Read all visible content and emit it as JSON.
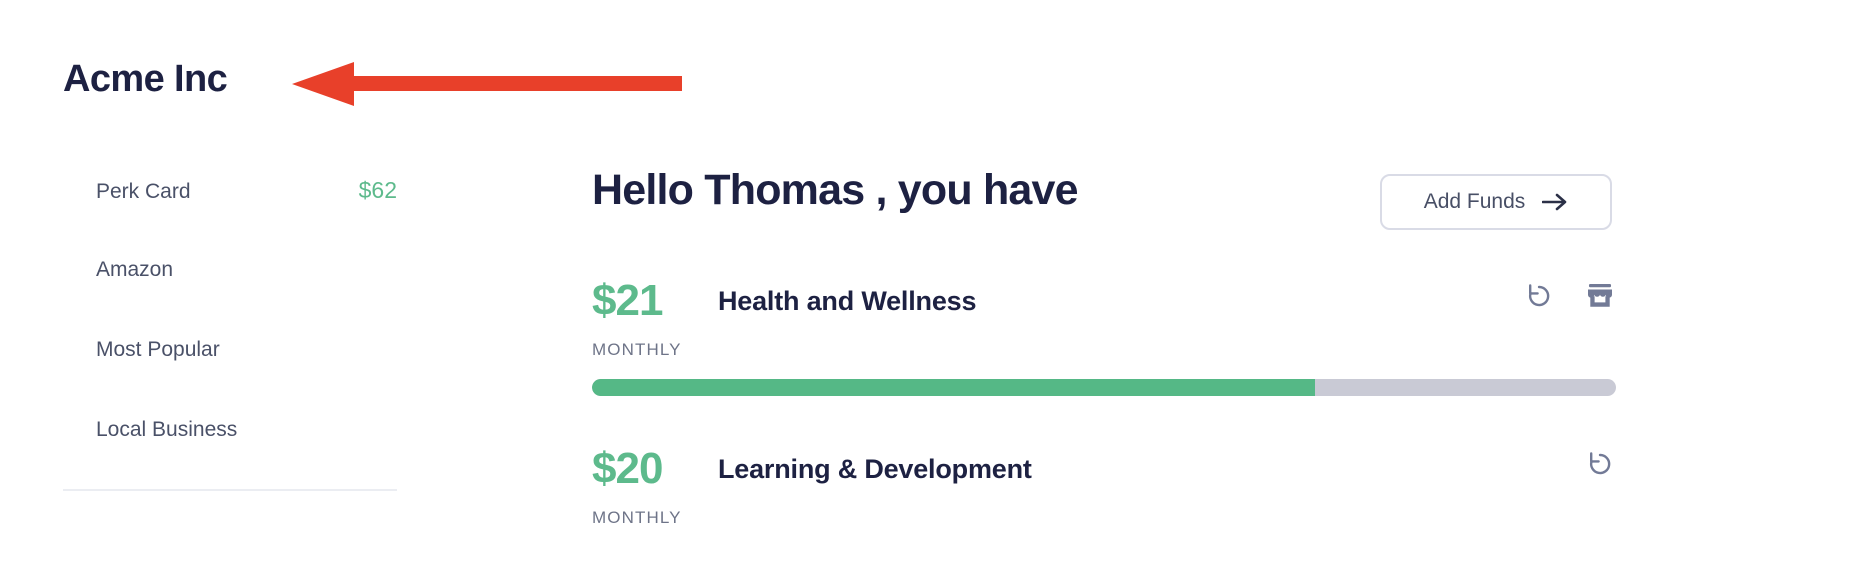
{
  "brand": {
    "title": "Acme Inc"
  },
  "annotation": {
    "type": "arrow-left",
    "color": "#e8402a",
    "points_to": "Acme Inc"
  },
  "sidebar": {
    "items": [
      {
        "label": "Perk Card",
        "value": "$62"
      },
      {
        "label": "Amazon",
        "value": ""
      },
      {
        "label": "Most Popular",
        "value": ""
      },
      {
        "label": "Local Business",
        "value": ""
      }
    ]
  },
  "main": {
    "greeting": "Hello Thomas , you have",
    "add_funds": {
      "label": "Add Funds",
      "icon": "arrow-right-icon"
    },
    "benefits": [
      {
        "amount": "$21",
        "name": "Health and Wellness",
        "period": "MONTHLY",
        "progress_percent": 70.6,
        "actions": [
          "rotate-ccw-icon",
          "storefront-icon"
        ]
      },
      {
        "amount": "$20",
        "name": "Learning & Development",
        "period": "MONTHLY",
        "progress_percent": 0,
        "actions": [
          "rotate-ccw-icon"
        ]
      }
    ]
  },
  "colors": {
    "accent_green": "#55b886",
    "heading_navy": "#1d2142",
    "muted_slate": "#6e7488",
    "track_gray": "#c9cad5",
    "annotation_red": "#e8402a"
  }
}
